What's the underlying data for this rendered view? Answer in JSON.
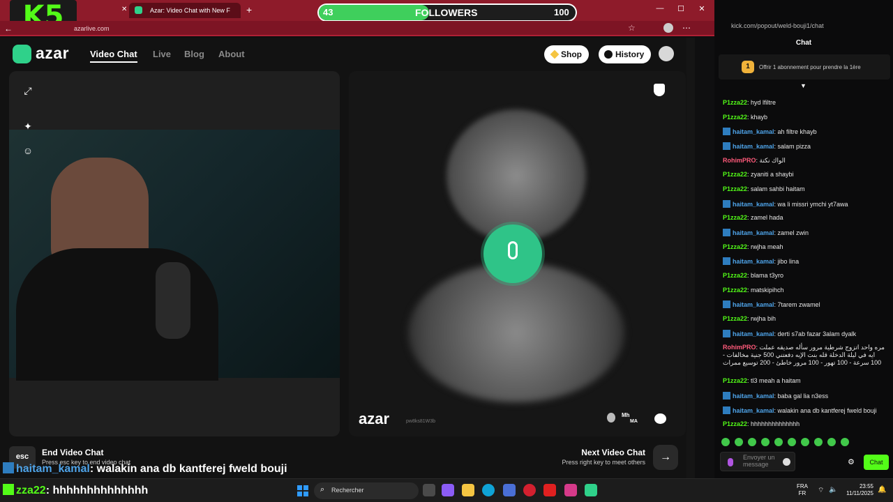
{
  "overlay": {
    "logo": "K5",
    "followers_label": "FOLLOWERS",
    "followers_current": "43",
    "followers_goal": "100",
    "progress": 0.43
  },
  "browser": {
    "tab_title": "Azar: Video Chat with New F",
    "url": "azarlive.com",
    "chat_url": "kick.com/popout/weld-bouji1/chat"
  },
  "nav": {
    "brand": "azar",
    "items": [
      "Video Chat",
      "Live",
      "Blog",
      "About"
    ],
    "shop": "Shop",
    "history": "History"
  },
  "video": {
    "watermark": "azar",
    "peer_code": "pw8ks81W3b",
    "peer_label": "Mh",
    "peer_country": "MA"
  },
  "footer": {
    "esc_key": "esc",
    "end_title": "End Video Chat",
    "end_sub": "Press esc key to end video chat",
    "next_title": "Next Video Chat",
    "next_sub": "Press right key to meet others"
  },
  "overlay_chat": [
    {
      "user": "haitam_kamal",
      "msg": ": walakin ana db kantferej fweld bouji"
    },
    {
      "user": "zza22",
      "msg": ": hhhhhhhhhhhhhh"
    }
  ],
  "chat": {
    "header": "Chat",
    "sub_text": "Offrir 1 abonnement pour prendre la 1ère",
    "sub_count": "1",
    "input_placeholder": "Envoyer un message",
    "send": "Chat",
    "messages": [
      {
        "user": "P1zza22",
        "color": "g",
        "badge": false,
        "text": ": hyd lfiltre"
      },
      {
        "user": "P1zza22",
        "color": "g",
        "badge": false,
        "text": ": khayb"
      },
      {
        "user": "haitam_kamal",
        "color": "b",
        "badge": true,
        "text": ": ah filtre khayb"
      },
      {
        "user": "haitam_kamal",
        "color": "b",
        "badge": true,
        "text": ": salam pizza"
      },
      {
        "user": "RohimPRO",
        "color": "r",
        "badge": false,
        "text": ": الواك نكتة"
      },
      {
        "user": "P1zza22",
        "color": "g",
        "badge": false,
        "text": ": zyaniti a shaybi"
      },
      {
        "user": "P1zza22",
        "color": "g",
        "badge": false,
        "text": ": salam sahbi haitam"
      },
      {
        "user": "haitam_kamal",
        "color": "b",
        "badge": true,
        "text": ": wa li missri ymchi yt7awa"
      },
      {
        "user": "P1zza22",
        "color": "g",
        "badge": false,
        "text": ": zamel hada"
      },
      {
        "user": "haitam_kamal",
        "color": "b",
        "badge": true,
        "text": ": zamel zwin"
      },
      {
        "user": "P1zza22",
        "color": "g",
        "badge": false,
        "text": ": rwjha meah"
      },
      {
        "user": "haitam_kamal",
        "color": "b",
        "badge": true,
        "text": ": jibo lina"
      },
      {
        "user": "P1zza22",
        "color": "g",
        "badge": false,
        "text": ": blama t3yro"
      },
      {
        "user": "P1zza22",
        "color": "g",
        "badge": false,
        "text": ": matskipihch"
      },
      {
        "user": "haitam_kamal",
        "color": "b",
        "badge": true,
        "text": ": 7tarem zwamel"
      },
      {
        "user": "P1zza22",
        "color": "g",
        "badge": false,
        "text": ": rwjha bih"
      },
      {
        "user": "haitam_kamal",
        "color": "b",
        "badge": true,
        "text": ": derti s7ab fazar 3alam dyalk"
      },
      {
        "user": "RohimPRO",
        "color": "r",
        "badge": false,
        "text": ": مره واحد اتزوج شرطية مرور سأله صديقه عملت ايه في ليلة الدخلة قله بنت الإيه دفعتني 500 جنية مخالفات - 100 سرعة - 100 تهور - 100 مرور خاطئ - 200 توسيع ممرات"
      },
      {
        "user": "P1zza22",
        "color": "g",
        "badge": false,
        "text": ": tl3 meah a haitam"
      },
      {
        "user": "haitam_kamal",
        "color": "b",
        "badge": true,
        "text": ": baba gal lia n3ess"
      },
      {
        "user": "haitam_kamal",
        "color": "b",
        "badge": true,
        "text": ": walakin ana db kantferej fweld bouji"
      },
      {
        "user": "P1zza22",
        "color": "g",
        "badge": false,
        "text": ": hhhhhhhhhhhhhh"
      }
    ]
  },
  "taskbar": {
    "search": "Rechercher",
    "lang1": "FRA",
    "lang2": "FR",
    "time": "23:55",
    "date": "11/11/2025"
  }
}
